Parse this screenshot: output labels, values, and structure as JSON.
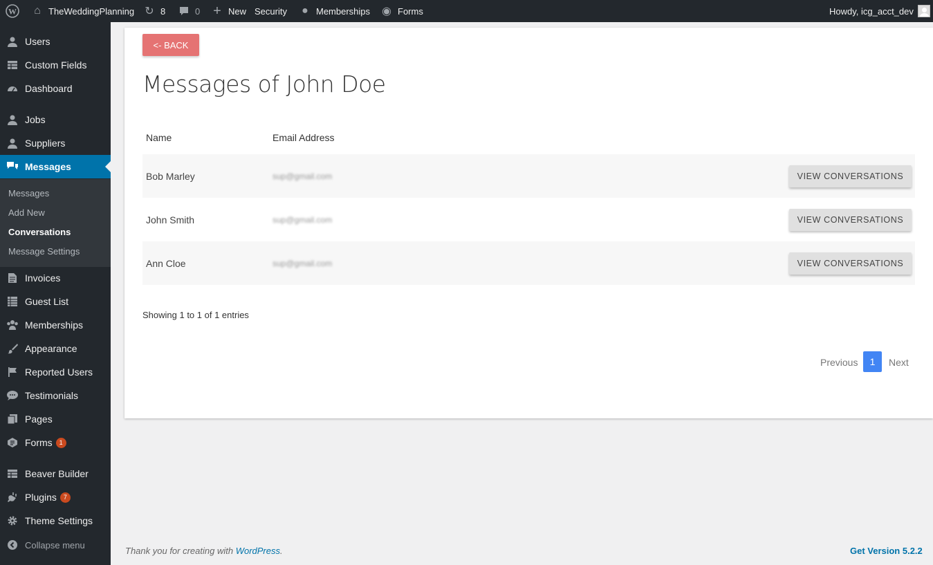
{
  "adminbar": {
    "site_name": "TheWeddingPlanning",
    "updates_count": "8",
    "comments_count": "0",
    "new_label": "New",
    "security_label": "Security",
    "memberships_label": "Memberships",
    "forms_label": "Forms",
    "howdy": "Howdy, icg_acct_dev"
  },
  "sidebar": {
    "items": [
      {
        "label": "Users",
        "icon": "user-icon"
      },
      {
        "label": "Custom Fields",
        "icon": "table-icon"
      },
      {
        "label": "Dashboard",
        "icon": "dashboard-icon"
      },
      {
        "label": "Jobs",
        "icon": "user-icon"
      },
      {
        "label": "Suppliers",
        "icon": "user-icon"
      },
      {
        "label": "Messages",
        "icon": "chat-icon"
      },
      {
        "label": "Invoices",
        "icon": "document-icon"
      },
      {
        "label": "Guest List",
        "icon": "list-icon"
      },
      {
        "label": "Memberships",
        "icon": "group-icon"
      },
      {
        "label": "Appearance",
        "icon": "brush-icon"
      },
      {
        "label": "Reported Users",
        "icon": "flag-icon"
      },
      {
        "label": "Testimonials",
        "icon": "comment-icon"
      },
      {
        "label": "Pages",
        "icon": "pages-icon"
      },
      {
        "label": "Forms",
        "icon": "forms-icon",
        "badge": "1"
      },
      {
        "label": "Beaver Builder",
        "icon": "table-icon"
      },
      {
        "label": "Plugins",
        "icon": "plugin-icon",
        "badge": "7"
      },
      {
        "label": "Theme Settings",
        "icon": "gear-icon"
      }
    ],
    "submenu": [
      "Messages",
      "Add New",
      "Conversations",
      "Message Settings"
    ],
    "collapse_label": "Collapse menu"
  },
  "main": {
    "back_label": "<- BACK",
    "title": "Messages of John Doe",
    "columns": [
      "Name",
      "Email Address"
    ],
    "rows": [
      {
        "name": "Bob Marley",
        "email": "sup@gmail.com",
        "action": "VIEW CONVERSATIONS"
      },
      {
        "name": "John Smith",
        "email": "sup@gmail.com",
        "action": "VIEW CONVERSATIONS"
      },
      {
        "name": "Ann Cloe",
        "email": "sup@gmail.com",
        "action": "VIEW CONVERSATIONS"
      }
    ],
    "showing": "Showing 1 to 1 of 1 entries",
    "pager": {
      "prev": "Previous",
      "current": "1",
      "next": "Next"
    }
  },
  "footer": {
    "thanks_prefix": "Thank you for creating with ",
    "wp_link": "WordPress",
    "thanks_suffix": ".",
    "version": "Get Version 5.2.2"
  },
  "colors": {
    "admin_bg": "#23282d",
    "active_menu": "#0073aa",
    "back_button": "#e57373",
    "pager_active": "#4285f4"
  }
}
